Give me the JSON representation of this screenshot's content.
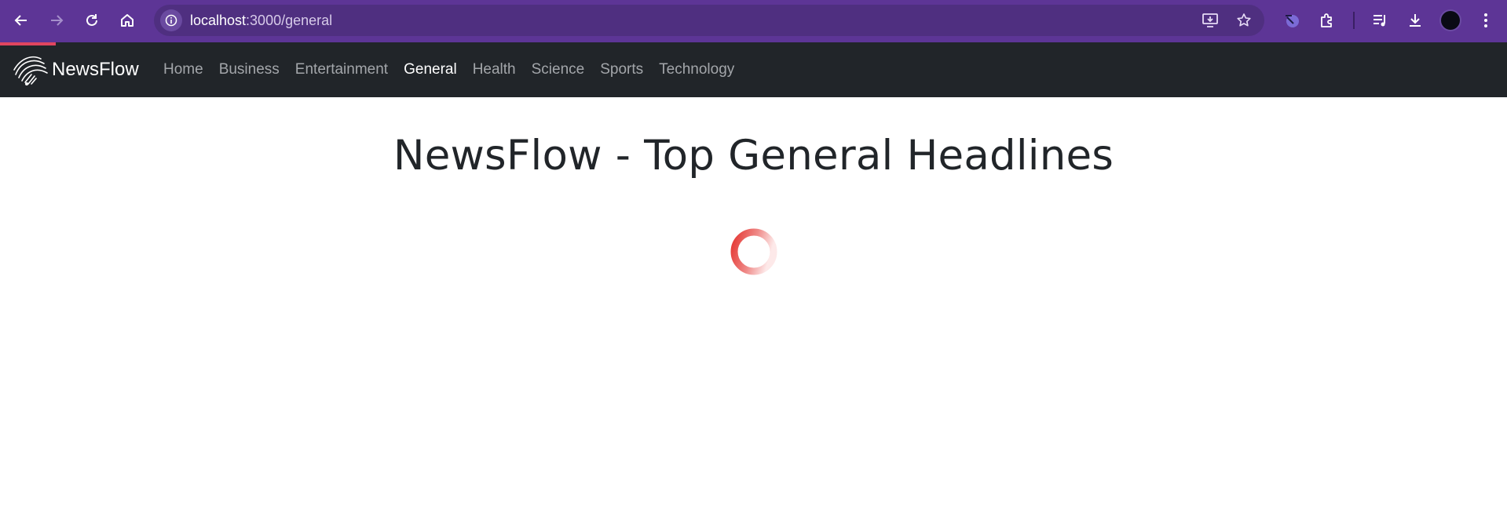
{
  "browser": {
    "url_host": "localhost",
    "url_path": ":3000/general",
    "icons": {
      "back": "arrow-left-icon",
      "forward": "arrow-right-icon",
      "reload": "reload-icon",
      "home": "home-icon",
      "site_info": "info-icon",
      "install": "install-app-icon",
      "bookmark": "star-icon",
      "extension_1": "extension-globe-icon",
      "extensions": "puzzle-icon",
      "media": "media-playlist-icon",
      "downloads": "download-icon",
      "profile": "profile-avatar-icon",
      "menu": "kebab-menu-icon"
    },
    "colors": {
      "frame": "#5d3596",
      "omnibox": "#4f2f80",
      "progress": "#e0455f"
    }
  },
  "navbar": {
    "brand": "NewsFlow",
    "links": [
      {
        "label": "Home",
        "active": false
      },
      {
        "label": "Business",
        "active": false
      },
      {
        "label": "Entertainment",
        "active": false
      },
      {
        "label": "General",
        "active": true
      },
      {
        "label": "Health",
        "active": false
      },
      {
        "label": "Science",
        "active": false
      },
      {
        "label": "Sports",
        "active": false
      },
      {
        "label": "Technology",
        "active": false
      }
    ],
    "colors": {
      "background": "#212529",
      "link": "#a3a6aa",
      "active": "#ffffff"
    }
  },
  "main": {
    "headline": "NewsFlow - Top General Headlines",
    "spinner": {
      "icon": "loading-spinner-icon",
      "color": "#e53935"
    }
  }
}
